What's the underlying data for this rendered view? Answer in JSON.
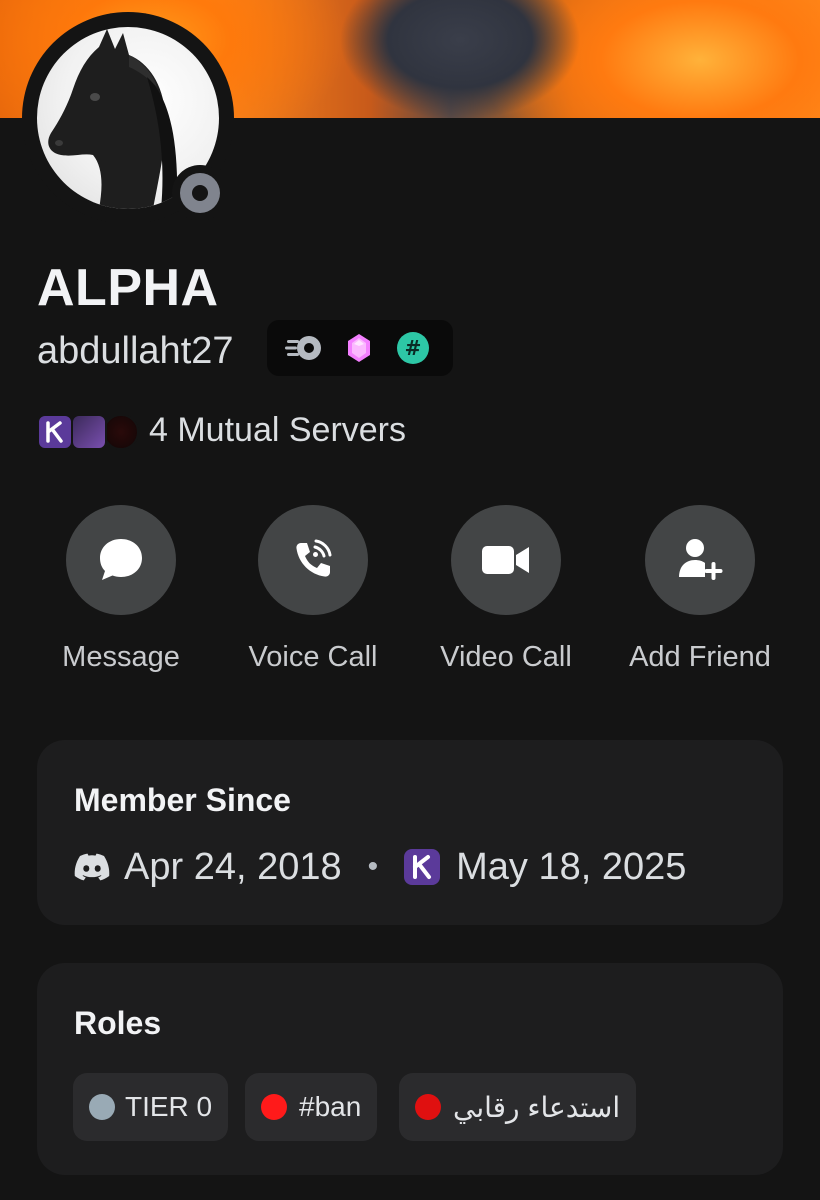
{
  "profile": {
    "display_name": "ALPHA",
    "username": "abdullaht27",
    "status": "offline",
    "badges": [
      {
        "icon": "speed-boost-badge-icon",
        "color": "#b5bac1"
      },
      {
        "icon": "pink-gem-badge-icon",
        "color": "#f47fff"
      },
      {
        "icon": "hashtag-badge-icon",
        "color": "#2dc7a6"
      }
    ]
  },
  "mutual": {
    "text": "4 Mutual Servers",
    "server_icons": [
      "server-icon-k",
      "server-icon-purple",
      "server-icon-dark"
    ]
  },
  "actions": [
    {
      "id": "message",
      "label": "Message",
      "icon": "message-bubble-icon"
    },
    {
      "id": "voice",
      "label": "Voice Call",
      "icon": "phone-call-icon"
    },
    {
      "id": "video",
      "label": "Video Call",
      "icon": "video-camera-icon"
    },
    {
      "id": "friend",
      "label": "Add Friend",
      "icon": "add-friend-icon"
    }
  ],
  "member_since": {
    "title": "Member Since",
    "discord_date": "Apr 24, 2018",
    "separator": "•",
    "server_date": "May 18, 2025"
  },
  "roles": {
    "title": "Roles",
    "items": [
      {
        "label": "TIER 0",
        "color": "#99aab5"
      },
      {
        "label": "#ban",
        "color": "#ff1a1a"
      },
      {
        "label": "استدعاء رقابي",
        "color": "#e01010"
      }
    ]
  },
  "colors": {
    "background": "#141414",
    "card": "#1d1d1e",
    "action_button": "#434546",
    "status_offline": "#80848e"
  }
}
